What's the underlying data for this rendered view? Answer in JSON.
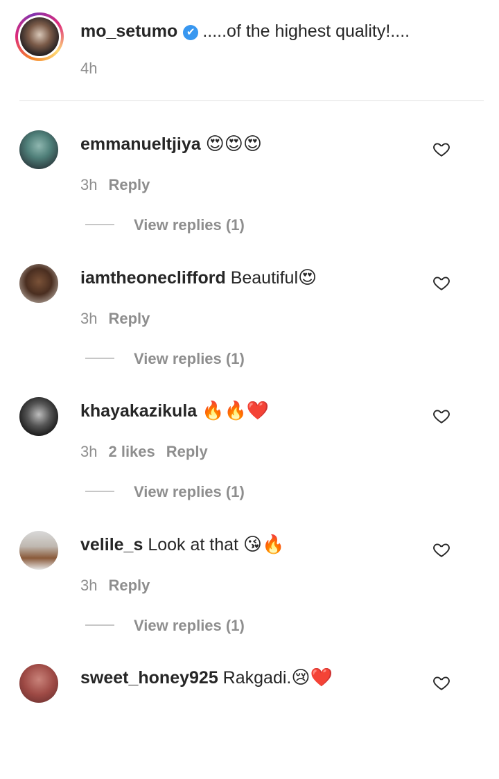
{
  "caption": {
    "username": "mo_setumo",
    "verified": "✔",
    "text": ".....of the highest quality!....",
    "time": "4h"
  },
  "comments": [
    {
      "username": "emmanueltjiya",
      "text": "",
      "emoji": "😍😍😍",
      "time": "3h",
      "likes": "",
      "reply": "Reply",
      "view_replies": "View replies (1)"
    },
    {
      "username": "iamtheoneclifford",
      "text": "Beautiful",
      "emoji": "😍",
      "time": "3h",
      "likes": "",
      "reply": "Reply",
      "view_replies": "View replies (1)"
    },
    {
      "username": "khayakazikula",
      "text": "",
      "emoji": "🔥🔥❤️",
      "time": "3h",
      "likes": "2 likes",
      "reply": "Reply",
      "view_replies": "View replies (1)"
    },
    {
      "username": "velile_s",
      "text": "Look at that",
      "emoji": "😘🔥",
      "time": "3h",
      "likes": "",
      "reply": "Reply",
      "view_replies": "View replies (1)"
    },
    {
      "username": "sweet_honey925",
      "text": "Rakgadi.",
      "emoji": "😢❤️",
      "time": "",
      "likes": "",
      "reply": "",
      "view_replies": ""
    }
  ],
  "colors": {
    "text": "#262626",
    "muted": "#8e8e8e",
    "verified": "#3897f0",
    "divider": "#e0e0e0"
  },
  "icons": {
    "like": "heart-outline-icon",
    "verified": "verified-badge-icon"
  }
}
